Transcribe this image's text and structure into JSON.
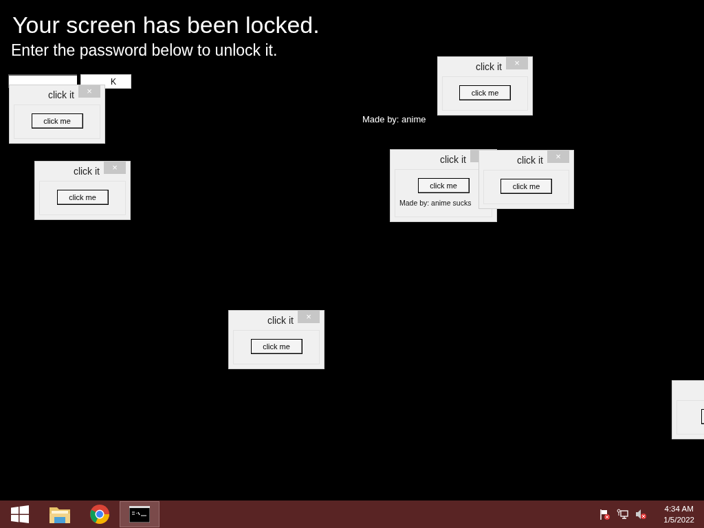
{
  "lock_screen": {
    "title": "Your screen has been locked.",
    "subtitle": "Enter the password below to unlock it.",
    "ok_button": "K",
    "credit": "Made by: anime"
  },
  "windows": [
    {
      "kind": "dialog",
      "title": "click it",
      "close": "×",
      "button": "click me"
    },
    {
      "kind": "dialog",
      "title": "click it",
      "close": "×",
      "button": "click me"
    },
    {
      "kind": "dialog",
      "title": "click it",
      "button": "click me",
      "credit": "Made by: anime sucks"
    },
    {
      "kind": "dialog",
      "title": "click it",
      "close": "×",
      "button": "click me"
    },
    {
      "kind": "dialog",
      "title": "click it",
      "close": "×",
      "button": "click me"
    },
    {
      "kind": "dialog",
      "title": "click it",
      "close": "×",
      "button": "click me"
    },
    {
      "kind": "offscreen"
    }
  ],
  "taskbar": {
    "apps": [
      {
        "kind": "start",
        "selected": false
      },
      {
        "kind": "folder",
        "selected": false
      },
      {
        "kind": "browser",
        "selected": false
      },
      {
        "kind": "terminal",
        "selected": true
      }
    ],
    "clock": {
      "time": "4:34 AM",
      "date": "1/5/2022"
    }
  }
}
